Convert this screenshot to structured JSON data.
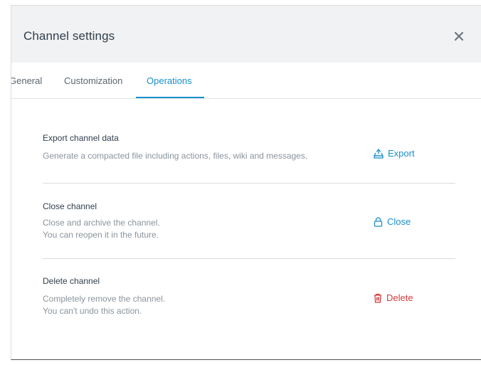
{
  "modal": {
    "title": "Channel settings"
  },
  "tabs": [
    {
      "label": "General"
    },
    {
      "label": "Customization"
    },
    {
      "label": "Operations",
      "active": true
    }
  ],
  "sections": [
    {
      "title": "Export channel data",
      "desc": [
        "Generate a compacted file including actions, files, wiki and messages."
      ],
      "action": {
        "label": "Export",
        "icon": "export-icon",
        "color": "#1a8fc9"
      }
    },
    {
      "title": "Close channel",
      "desc": [
        "Close and archive the channel.",
        "You can reopen it in the future."
      ],
      "action": {
        "label": "Close",
        "icon": "lock-icon",
        "color": "#1a8fc9"
      }
    },
    {
      "title": "Delete channel",
      "desc": [
        "Completely remove the channel.",
        "You can't undo this action."
      ],
      "action": {
        "label": "Delete",
        "icon": "trash-icon",
        "color": "#d23b3b"
      }
    }
  ],
  "colors": {
    "accent": "#1a8fc9",
    "danger": "#d23b3b",
    "header_bg": "#f1f2f3"
  }
}
